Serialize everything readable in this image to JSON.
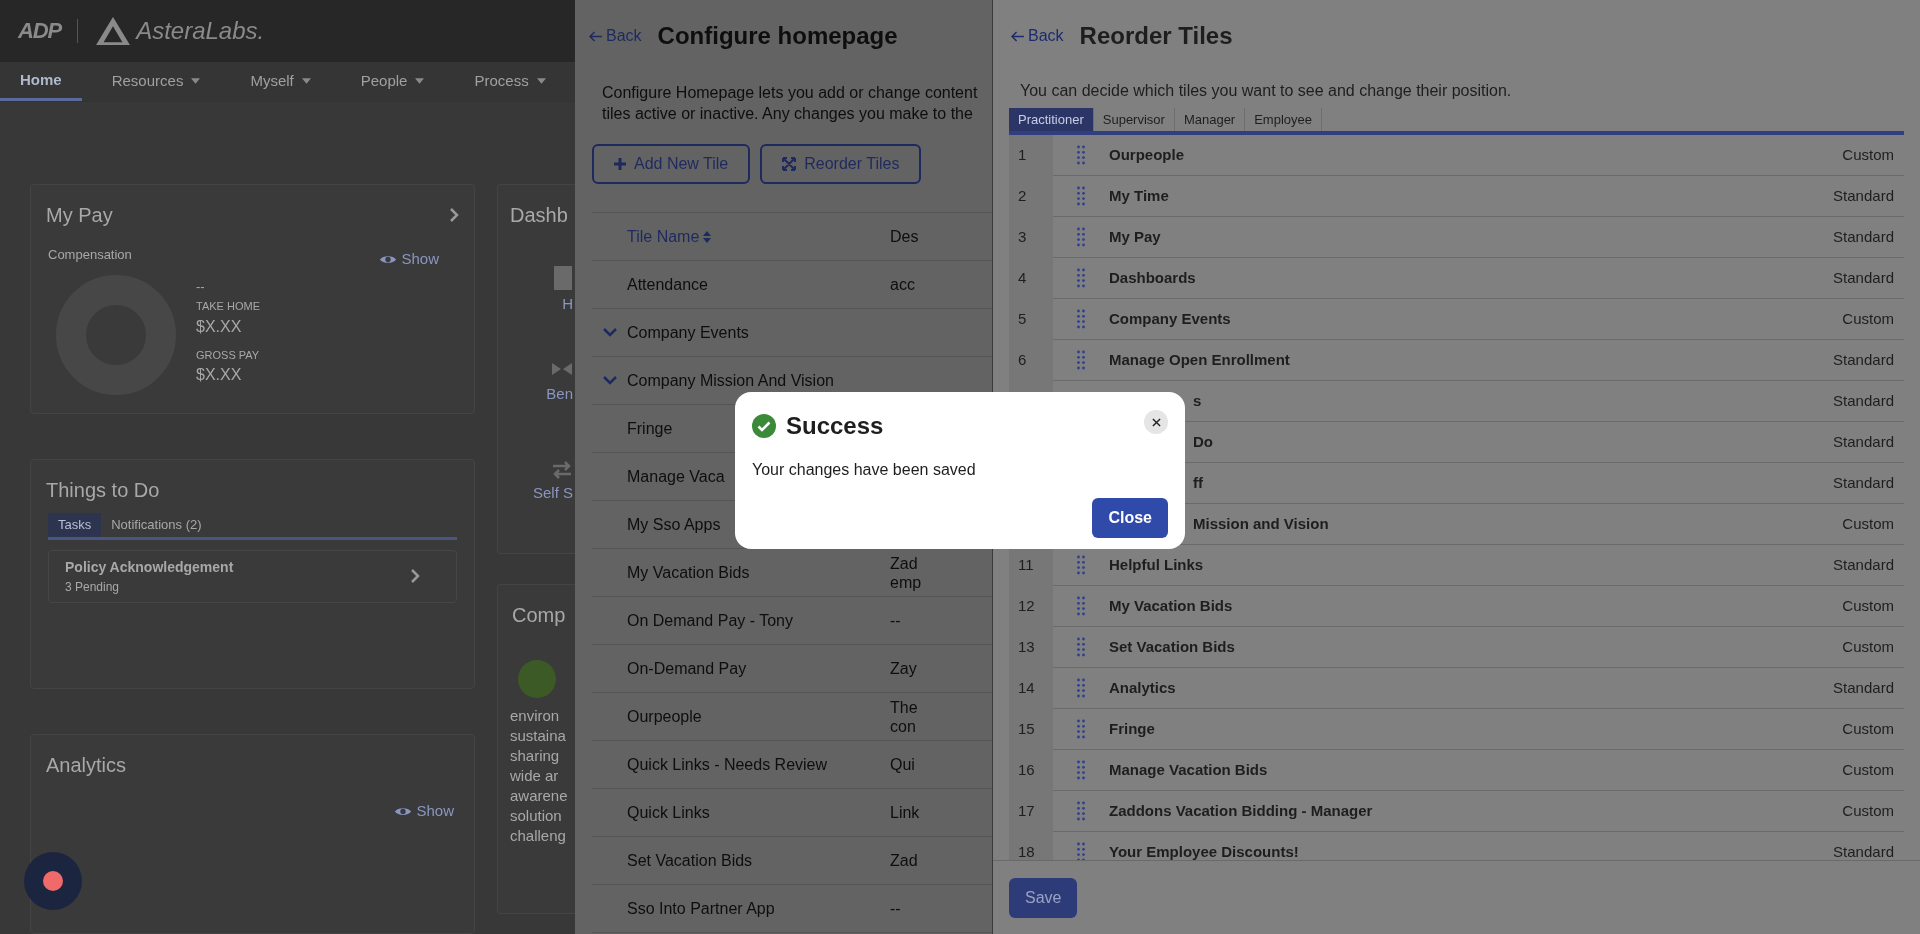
{
  "base_page": {
    "logo_mark": "ADP",
    "company_logo": "AsteraLabs.",
    "nav": [
      {
        "label": "Home",
        "selected": true,
        "dropdown": false
      },
      {
        "label": "Resources",
        "selected": false,
        "dropdown": true
      },
      {
        "label": "Myself",
        "selected": false,
        "dropdown": true
      },
      {
        "label": "People",
        "selected": false,
        "dropdown": true
      },
      {
        "label": "Process",
        "selected": false,
        "dropdown": true
      }
    ],
    "my_pay": {
      "title": "My Pay",
      "subtitle": "Compensation",
      "show": "Show",
      "dash": "--",
      "take_home_label": "TAKE HOME",
      "take_home": "$X.XX",
      "gross_label": "GROSS PAY",
      "gross": "$X.XX"
    },
    "things_to_do": {
      "title": "Things to Do",
      "tabs": [
        {
          "label": "Tasks",
          "selected": true
        },
        {
          "label": "Notifications (2)",
          "selected": false
        }
      ],
      "task": {
        "title": "Policy Acknowledgement",
        "subtitle": "3 Pending"
      }
    },
    "analytics": {
      "title": "Analytics",
      "show": "Show"
    },
    "dashboards_card": {
      "title": "Dashb",
      "items": [
        {
          "kind": "document",
          "label": "H"
        },
        {
          "kind": "bow",
          "label": "Ben"
        },
        {
          "kind": "arrows",
          "label": "Self S"
        }
      ]
    },
    "company_card": {
      "title": "Comp",
      "lines": [
        "environ",
        "sustaina",
        "sharing",
        "wide ar",
        "awarene",
        "solution",
        "challeng"
      ]
    }
  },
  "configure_panel": {
    "back": "Back",
    "title": "Configure homepage",
    "description": "Configure Homepage lets you add or change content tiles active or inactive. Any changes you make to the",
    "buttons": [
      {
        "kind": "add",
        "label": "Add New Tile"
      },
      {
        "kind": "reorder",
        "label": "Reorder Tiles"
      }
    ],
    "columns": [
      "Tile Name",
      "Des"
    ],
    "rows": [
      {
        "name": "Attendance",
        "expandable": false,
        "description": [
          "acc"
        ]
      },
      {
        "name": "Company Events",
        "expandable": true,
        "description": []
      },
      {
        "name": "Company Mission And Vision",
        "expandable": true,
        "description": []
      },
      {
        "name": "Fringe",
        "expandable": false,
        "description": []
      },
      {
        "name": "Manage Vaca",
        "expandable": false,
        "description": []
      },
      {
        "name": "My Sso Apps",
        "expandable": false,
        "description": []
      },
      {
        "name": "My Vacation Bids",
        "expandable": false,
        "description": [
          "Zad",
          "emp"
        ]
      },
      {
        "name": "On Demand Pay - Tony",
        "expandable": false,
        "description": [
          "--"
        ]
      },
      {
        "name": "On-Demand Pay",
        "expandable": false,
        "description": [
          "Zay"
        ]
      },
      {
        "name": "Ourpeople",
        "expandable": false,
        "description": [
          "The",
          "con"
        ]
      },
      {
        "name": "Quick Links - Needs Review",
        "expandable": false,
        "description": [
          "Qui"
        ]
      },
      {
        "name": "Quick Links",
        "expandable": false,
        "description": [
          "Link"
        ]
      },
      {
        "name": "Set Vacation Bids",
        "expandable": false,
        "description": [
          "Zad"
        ]
      },
      {
        "name": "Sso Into Partner App",
        "expandable": false,
        "description": [
          "--"
        ]
      }
    ]
  },
  "reorder_panel": {
    "back": "Back",
    "title": "Reorder Tiles",
    "description": "You can decide which tiles you want to see and change their position.",
    "tabs": [
      {
        "label": "Practitioner",
        "selected": true
      },
      {
        "label": "Supervisor",
        "selected": false
      },
      {
        "label": "Manager",
        "selected": false
      },
      {
        "label": "Employee",
        "selected": false
      }
    ],
    "tiles": [
      {
        "number": "1",
        "name": "Ourpeople",
        "type": "Custom"
      },
      {
        "number": "2",
        "name": "My Time",
        "type": "Standard"
      },
      {
        "number": "3",
        "name": "My Pay",
        "type": "Standard"
      },
      {
        "number": "4",
        "name": "Dashboards",
        "type": "Standard"
      },
      {
        "number": "5",
        "name": "Company Events",
        "type": "Custom"
      },
      {
        "number": "6",
        "name": "Manage Open Enrollment",
        "type": "Standard"
      },
      {
        "name": "s",
        "type": "Standard"
      },
      {
        "name": "Do",
        "type": "Standard"
      },
      {
        "name": "ff",
        "type": "Standard"
      },
      {
        "name": "Mission and Vision",
        "type": "Custom"
      },
      {
        "number": "11",
        "name": "Helpful Links",
        "type": "Standard"
      },
      {
        "number": "12",
        "name": "My Vacation Bids",
        "type": "Custom"
      },
      {
        "number": "13",
        "name": "Set Vacation Bids",
        "type": "Custom"
      },
      {
        "number": "14",
        "name": "Analytics",
        "type": "Standard"
      },
      {
        "number": "15",
        "name": "Fringe",
        "type": "Custom"
      },
      {
        "number": "16",
        "name": "Manage Vacation Bids",
        "type": "Custom"
      },
      {
        "number": "17",
        "name": "Zaddons Vacation Bidding - Manager",
        "type": "Custom"
      },
      {
        "number": "18",
        "name": "Your Employee Discounts!",
        "type": "Standard"
      }
    ],
    "save": "Save"
  },
  "dialog": {
    "title": "Success",
    "message": "Your changes have been saved",
    "close": "Close"
  }
}
